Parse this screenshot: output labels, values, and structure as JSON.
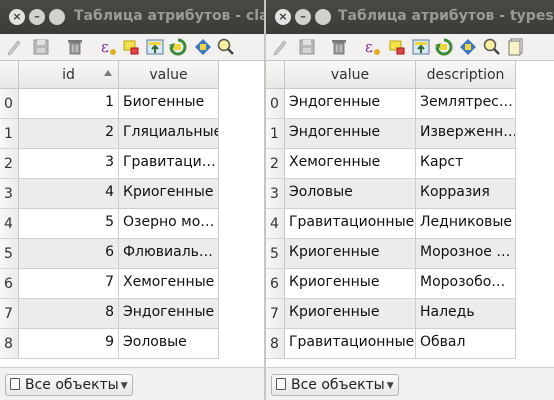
{
  "windows": [
    {
      "title": "Таблица атрибутов - class",
      "columns": [
        {
          "label": "id",
          "sorted": true
        },
        {
          "label": "value"
        }
      ],
      "rows": [
        {
          "n": "0",
          "c": [
            "1",
            "Биогенные"
          ]
        },
        {
          "n": "1",
          "c": [
            "2",
            "Гляциальные"
          ]
        },
        {
          "n": "2",
          "c": [
            "3",
            "Гравитаци…"
          ]
        },
        {
          "n": "3",
          "c": [
            "4",
            "Криогенные"
          ]
        },
        {
          "n": "4",
          "c": [
            "5",
            "Озерно мо…"
          ]
        },
        {
          "n": "5",
          "c": [
            "6",
            "Флювиаль…"
          ]
        },
        {
          "n": "6",
          "c": [
            "7",
            "Хемогенные"
          ]
        },
        {
          "n": "7",
          "c": [
            "8",
            "Эндогенные"
          ]
        },
        {
          "n": "8",
          "c": [
            "9",
            "Эоловые"
          ]
        }
      ],
      "filter_label": "Все объекты"
    },
    {
      "title": "Таблица атрибутов - types :: B",
      "columns": [
        {
          "label": "value"
        },
        {
          "label": "description"
        }
      ],
      "rows": [
        {
          "n": "0",
          "c": [
            "Эндогенные",
            "Землятрес…"
          ]
        },
        {
          "n": "1",
          "c": [
            "Эндогенные",
            "Изверженн…"
          ]
        },
        {
          "n": "2",
          "c": [
            "Хемогенные",
            "Карст"
          ]
        },
        {
          "n": "3",
          "c": [
            "Эоловые",
            "Корразия"
          ]
        },
        {
          "n": "4",
          "c": [
            "Гравитационные",
            "Ледниковые"
          ]
        },
        {
          "n": "5",
          "c": [
            "Криогенные",
            "Морозное …"
          ]
        },
        {
          "n": "6",
          "c": [
            "Криогенные",
            "Морозобо…"
          ]
        },
        {
          "n": "7",
          "c": [
            "Криогенные",
            "Наледь"
          ]
        },
        {
          "n": "8",
          "c": [
            "Гравитационные",
            "Обвал"
          ]
        }
      ],
      "filter_label": "Все объекты"
    }
  ],
  "icons": [
    "pencil-icon",
    "save-icon",
    "delete-icon",
    "expression-icon",
    "select-by-expression-icon",
    "deselect-icon",
    "move-selection-to-top-icon",
    "invert-selection-icon",
    "pan-to-selected-icon",
    "zoom-to-selected-icon",
    "copy-rows-icon"
  ],
  "colors": {
    "titlebar": "#3c3b37",
    "close_button": "#e2e2e0",
    "alt_row": "#ececeb"
  }
}
